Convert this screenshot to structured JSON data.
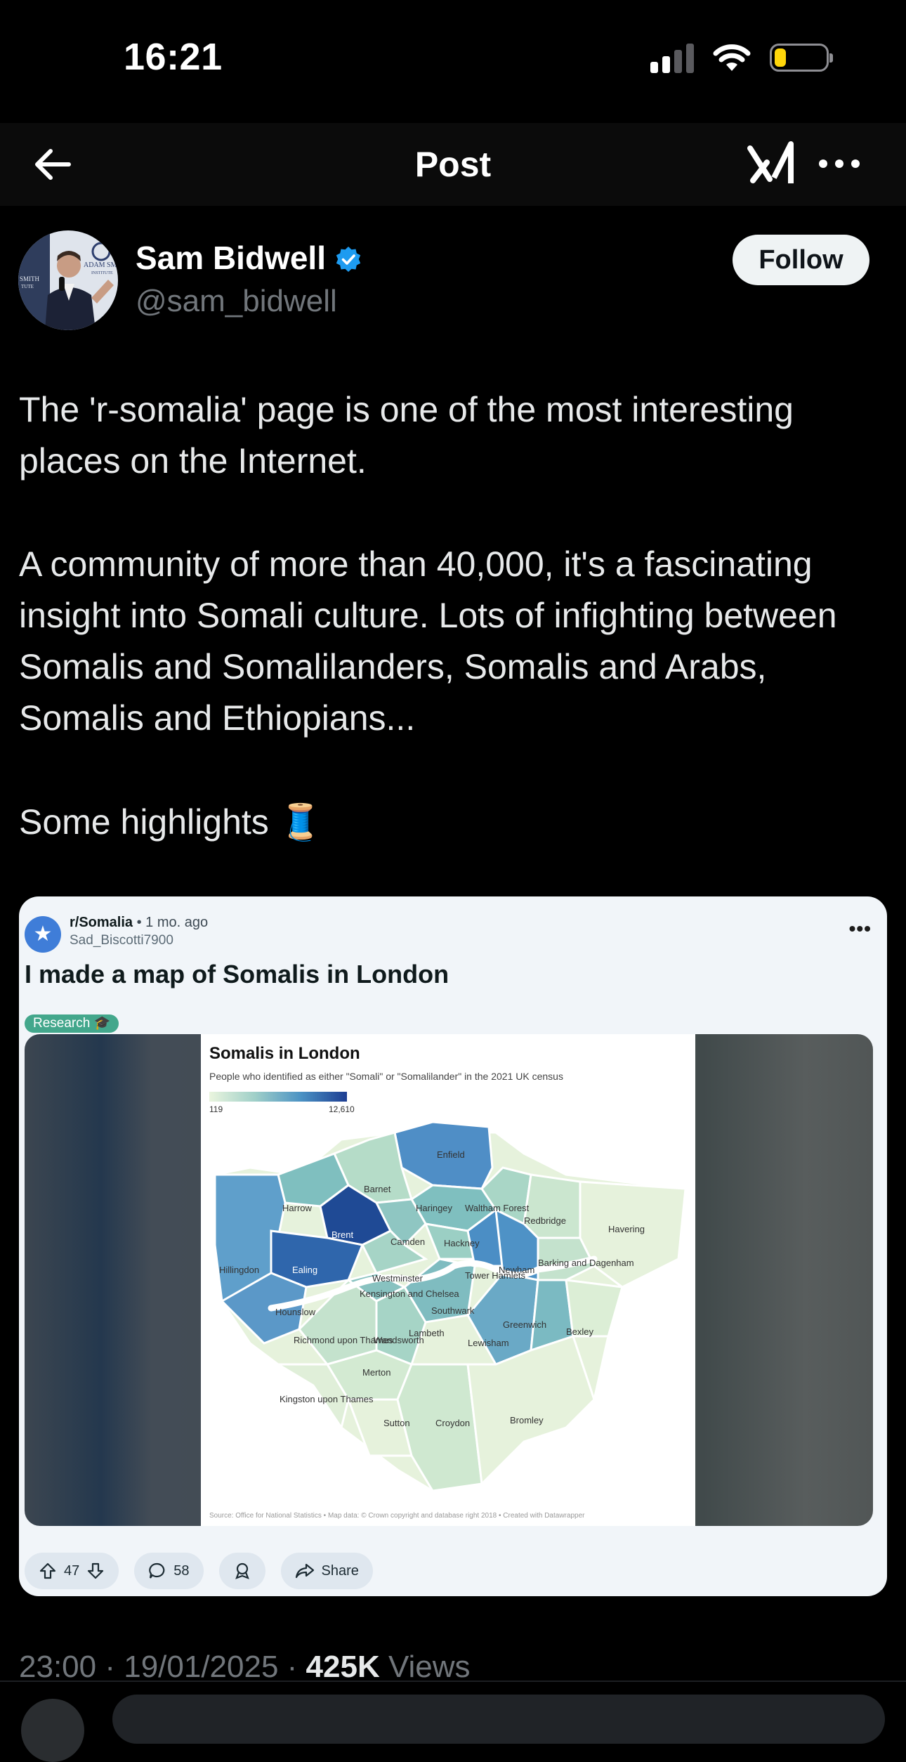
{
  "status_bar": {
    "time": "16:21",
    "signal_bars_active": 2,
    "signal_bars_total": 4,
    "battery_level": 0.2,
    "battery_color": "#ffd60a"
  },
  "nav": {
    "back_icon": "arrow-left-icon",
    "title": "Post",
    "grok_icon": "grok-icon",
    "more_icon": "more-horizontal-icon"
  },
  "author": {
    "name": "Sam Bidwell",
    "handle": "@sam_bidwell",
    "verified": true,
    "avatar_label_1": "ADAM SM",
    "avatar_label_2": "INSTITUTE",
    "avatar_label_3": "SMITH",
    "avatar_label_4": "TUTE",
    "follow_label": "Follow"
  },
  "post": {
    "paragraphs": [
      "The 'r-somalia' page is one of the most interesting places on the Internet.",
      "A community of more than 40,000, it's a fascinating insight into Somali culture. Lots of infighting between Somalis and Somalilanders, Somalis and Arabs, Somalis and Ethiopians...",
      "Some highlights 🧵"
    ]
  },
  "embed": {
    "subreddit": "r/Somalia",
    "age": "1 mo. ago",
    "username": "Sad_Biscotti7900",
    "title": "I made a map of Somalis in London",
    "flair": "Research 🎓",
    "more": "•••",
    "upvotes": "47",
    "comments": "58",
    "share": "Share",
    "map": {
      "title": "Somalis in London",
      "subtitle": "People who identified as either \"Somali\" or \"Somalilander\" in the 2021 UK census",
      "legend_min": "119",
      "legend_max": "12,610",
      "source": "Source: Office for National Statistics • Map data: © Crown copyright and database right 2018 • Created with Datawrapper",
      "boroughs": [
        "Enfield",
        "Barnet",
        "Harrow",
        "Haringey",
        "Waltham Forest",
        "Redbridge",
        "Havering",
        "Brent",
        "Camden",
        "Hackney",
        "Hillingdon",
        "Ealing",
        "Westminster",
        "Tower Hamlets",
        "Newham",
        "Barking and Dagenham",
        "Kensington and Chelsea",
        "Hounslow",
        "Southwark",
        "Greenwich",
        "Bexley",
        "Richmond upon Thames",
        "Wandsworth",
        "Lambeth",
        "Lewisham",
        "Merton",
        "Kingston upon Thames",
        "Sutton",
        "Croydon",
        "Bromley"
      ]
    }
  },
  "meta": {
    "time": "23:00",
    "date": "19/01/2025",
    "views_count": "425K",
    "views_label": "Views"
  },
  "colors": {
    "background": "#000000",
    "text": "#e7e9ea",
    "muted": "#71767b",
    "verified": "#1d9bf0",
    "follow_bg": "#eff3f4"
  }
}
